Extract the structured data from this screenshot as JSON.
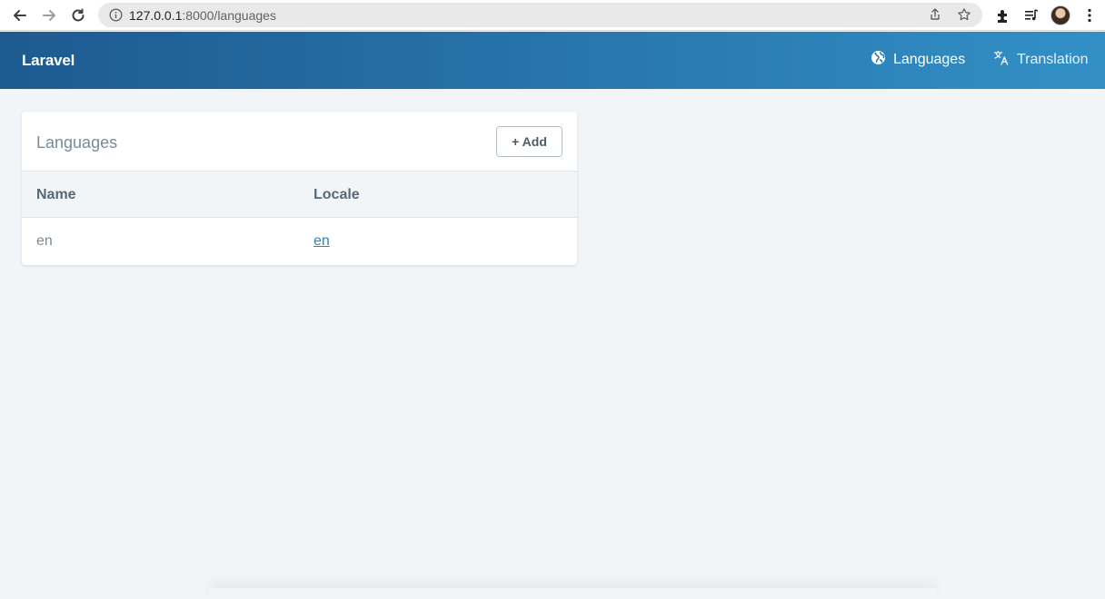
{
  "browser": {
    "url_host": "127.0.0.1",
    "url_path": ":8000/languages"
  },
  "app": {
    "brand": "Laravel",
    "nav": [
      {
        "label": "Languages",
        "icon": "globe-icon"
      },
      {
        "label": "Translation",
        "icon": "translate-icon"
      }
    ]
  },
  "card": {
    "title": "Languages",
    "add_label": "+ Add",
    "columns": [
      "Name",
      "Locale"
    ],
    "rows": [
      {
        "name": "en",
        "locale": "en"
      }
    ]
  },
  "colors": {
    "header_start": "#1d5a90",
    "header_end": "#3290c6",
    "link": "#2a83c4",
    "background": "#f1f5f8"
  }
}
